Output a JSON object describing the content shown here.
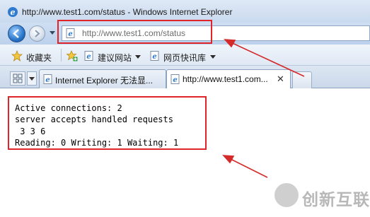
{
  "window": {
    "title": "http://www.test1.com/status - Windows Internet Explorer"
  },
  "navigation": {
    "back_icon": "back-arrow-icon",
    "forward_icon": "forward-arrow-icon",
    "address_value": "http://www.test1.com/status"
  },
  "favorites_bar": {
    "favorites_label": "收藏夹",
    "links": [
      {
        "label": "建议网站",
        "icon": "ie-page-icon"
      },
      {
        "label": "网页快讯库",
        "icon": "ie-page-icon"
      }
    ]
  },
  "tabs": [
    {
      "title": "Internet Explorer 无法显...",
      "active": false
    },
    {
      "title": "http://www.test1.com...",
      "active": true
    }
  ],
  "page": {
    "lines": [
      "Active connections: 2",
      "server accepts handled requests",
      " 3 3 6",
      "Reading: 0 Writing: 1 Waiting: 1"
    ]
  },
  "annotation": {
    "highlight_color": "#e0252a"
  },
  "watermark": {
    "text": "创新互联"
  }
}
